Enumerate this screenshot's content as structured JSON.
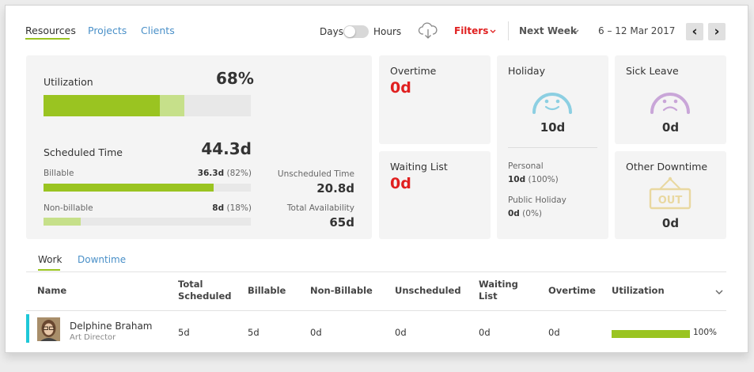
{
  "nav": {
    "tabs": [
      "Resources",
      "Projects",
      "Clients"
    ]
  },
  "toolbar": {
    "days_label": "Days",
    "hours_label": "Hours",
    "filters_label": "Filters",
    "period_label": "Next Week",
    "date_range": "6 – 12 Mar 2017",
    "prev_arrow": "‹",
    "next_arrow": "›"
  },
  "summary": {
    "utilization_label": "Utilization",
    "utilization_value": "68%",
    "utilization_bar": {
      "billable_pct": 56,
      "nonbillable_pct": 12
    },
    "scheduled_label": "Scheduled Time",
    "scheduled_value": "44.3d",
    "billable_label": "Billable",
    "billable_value": "36.3d",
    "billable_pct_text": "(82%)",
    "billable_bar_pct": 82,
    "nonbillable_label": "Non-billable",
    "nonbillable_value": "8d",
    "nonbillable_pct_text": "(18%)",
    "nonbillable_bar_pct": 18,
    "unscheduled_label": "Unscheduled Time",
    "unscheduled_value": "20.8d",
    "availability_label": "Total Availability",
    "availability_value": "65d"
  },
  "stats": {
    "overtime_label": "Overtime",
    "overtime_value": "0d",
    "waiting_label": "Waiting List",
    "waiting_value": "0d",
    "holiday_label": "Holiday",
    "holiday_value": "10d",
    "personal_label": "Personal",
    "personal_value": "10d",
    "personal_pct": "(100%)",
    "public_label": "Public Holiday",
    "public_value": "0d",
    "public_pct": "(0%)",
    "sick_label": "Sick Leave",
    "sick_value": "0d",
    "downtime_label": "Other Downtime",
    "downtime_value": "0d",
    "out_sign_text": "OUT"
  },
  "subtabs": [
    "Work",
    "Downtime"
  ],
  "table": {
    "headers": {
      "name": "Name",
      "total_1": "Total",
      "total_2": "Scheduled",
      "billable": "Billable",
      "nonbillable": "Non-Billable",
      "unscheduled": "Unscheduled",
      "waiting_1": "Waiting",
      "waiting_2": "List",
      "overtime": "Overtime",
      "utilization": "Utilization"
    },
    "rows": [
      {
        "name": "Delphine Braham",
        "role": "Art Director",
        "total": "5d",
        "billable": "5d",
        "nonbillable": "0d",
        "unscheduled": "0d",
        "waiting": "0d",
        "overtime": "0d",
        "utilization": "100%",
        "utilization_fraction": 1.0
      }
    ]
  },
  "colors": {
    "accent_green": "#9ac421",
    "light_green": "#c6e08a",
    "red": "#e02020",
    "link_blue": "#4a90c8",
    "row_marker": "#1ec8d8",
    "holiday_face": "#8ccfe2",
    "sick_face": "#c9a6d8",
    "out_sign": "#e9d8a0"
  }
}
